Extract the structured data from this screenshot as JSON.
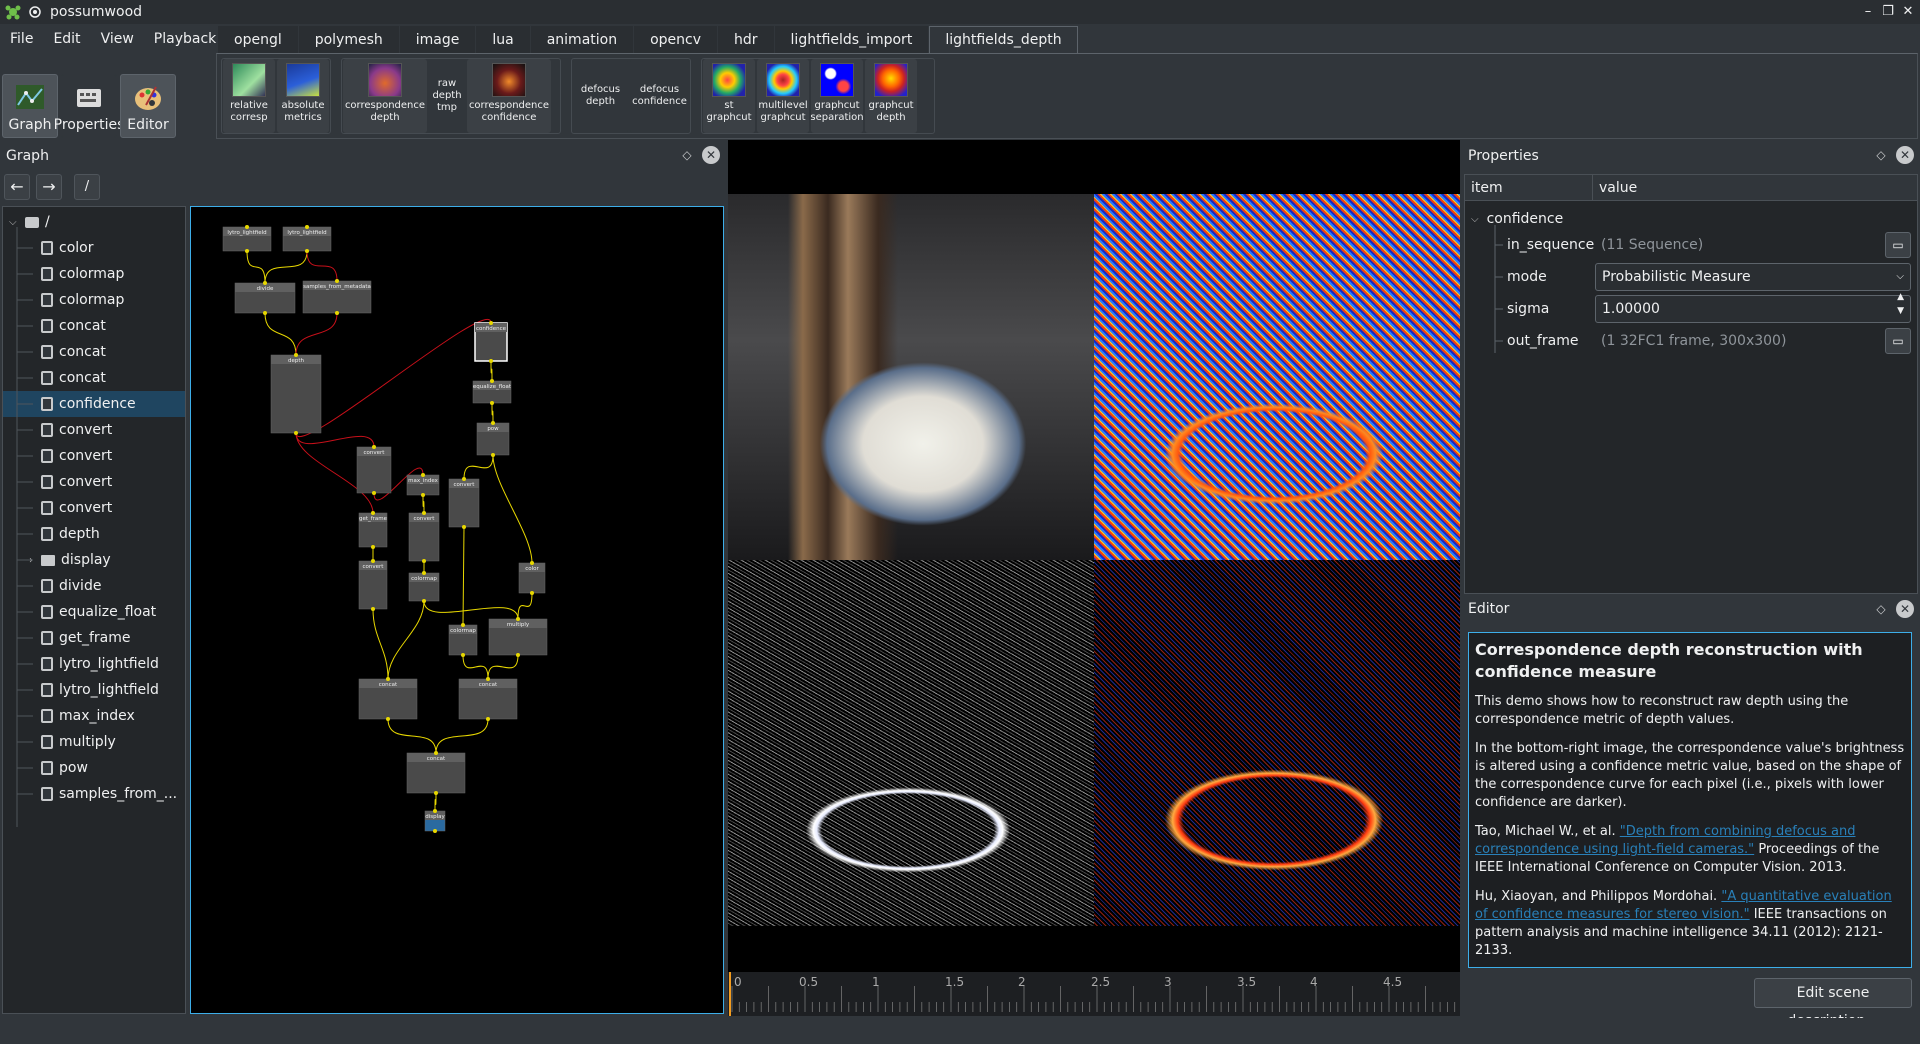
{
  "window": {
    "title": "possumwood",
    "controls": [
      "–",
      "❐",
      "✕"
    ]
  },
  "menu": [
    "File",
    "Edit",
    "View",
    "Playback"
  ],
  "modes": [
    {
      "label": "Graph",
      "icon": "graph-icon"
    },
    {
      "label": "Properties",
      "icon": "properties-icon"
    },
    {
      "label": "Editor",
      "icon": "editor-palette-icon"
    }
  ],
  "tabs": [
    "opengl",
    "polymesh",
    "image",
    "lua",
    "animation",
    "opencv",
    "hdr",
    "lightfields_import",
    "lightfields_depth"
  ],
  "active_tab": "lightfields_depth",
  "toolbox": {
    "relative_corresp": "relative\ncorresp",
    "absolute_metrics": "absolute\nmetrics",
    "correspondence_depth": "correspondence\ndepth",
    "raw_depth_tmp": "raw\ndepth\ntmp",
    "correspondence_confidence": "correspondence\nconfidence",
    "defocus_depth": "defocus\ndepth",
    "defocus_confidence": "defocus\nconfidence",
    "st_graphcut": "st\ngraphcut",
    "multilevel_graphcut": "multilevel\ngraphcut",
    "graphcut_separation": "graphcut\nseparation",
    "graphcut_depth": "graphcut\ndepth"
  },
  "graph": {
    "title": "Graph",
    "path": "/",
    "tree_root": "/",
    "tree_items": [
      "color",
      "colormap",
      "colormap",
      "concat",
      "concat",
      "concat",
      "confidence",
      "convert",
      "convert",
      "convert",
      "convert",
      "depth",
      "display",
      "divide",
      "equalize_float",
      "get_frame",
      "lytro_lightfield",
      "lytro_lightfield",
      "max_index",
      "multiply",
      "pow",
      "samples_from_..."
    ],
    "selected_item": "confidence"
  },
  "nodes": {
    "lytro1": "lytro_lightfield",
    "lytro2": "lytro_lightfield",
    "divide": "divide",
    "samples": "samples_from_metadata",
    "depth": "depth",
    "confidence": "confidence",
    "equalize": "equalize_float",
    "pow": "pow",
    "convert1": "convert",
    "max_index": "max_index",
    "convert2": "convert",
    "convert3": "convert",
    "get_frame": "get_frame",
    "convert4": "convert",
    "colormap1": "colormap",
    "color": "color",
    "colormap2": "colormap",
    "multiply": "multiply",
    "concat1": "concat",
    "concat2": "concat",
    "concat3": "concat",
    "display": "display"
  },
  "timeline": {
    "ticks": [
      "0",
      "0.5",
      "1",
      "1.5",
      "2",
      "2.5",
      "3",
      "3.5",
      "4",
      "4.5"
    ]
  },
  "properties": {
    "title": "Properties",
    "col_item": "item",
    "col_value": "value",
    "group": "confidence",
    "rows": [
      {
        "name": "in_sequence",
        "value": "(11 Sequence)"
      },
      {
        "name": "mode",
        "value": "Probabilistic Measure"
      },
      {
        "name": "sigma",
        "value": "1.00000"
      },
      {
        "name": "out_frame",
        "value": "(1 32FC1 frame, 300x300)"
      }
    ]
  },
  "editor": {
    "title": "Editor",
    "heading": "Correspondence depth reconstruction with confidence measure",
    "p1": "This demo shows how to reconstruct raw depth using the correspondence metric of depth values.",
    "p2": "In the bottom-right image, the correspondence value's brightness is altered using a confidence metric value, based on the shape of the correspondence curve for each pixel (i.e., pixels with lower confidence are darker).",
    "ref1_authors": "Tao, Michael W., et al.",
    "ref1_link": "\"Depth from combining defocus and correspondence using light-field cameras.\"",
    "ref1_rest": "Proceedings of the IEEE International Conference on Computer Vision. 2013.",
    "ref2_authors": "Hu, Xiaoyan, and Philippos Mordohai.",
    "ref2_link": "\"A quantitative evaluation of confidence measures for stereo vision.\"",
    "ref2_rest": "IEEE transactions on pattern analysis and machine intelligence 34.11 (2012): 2121-2133.",
    "button": "Edit scene description..."
  }
}
